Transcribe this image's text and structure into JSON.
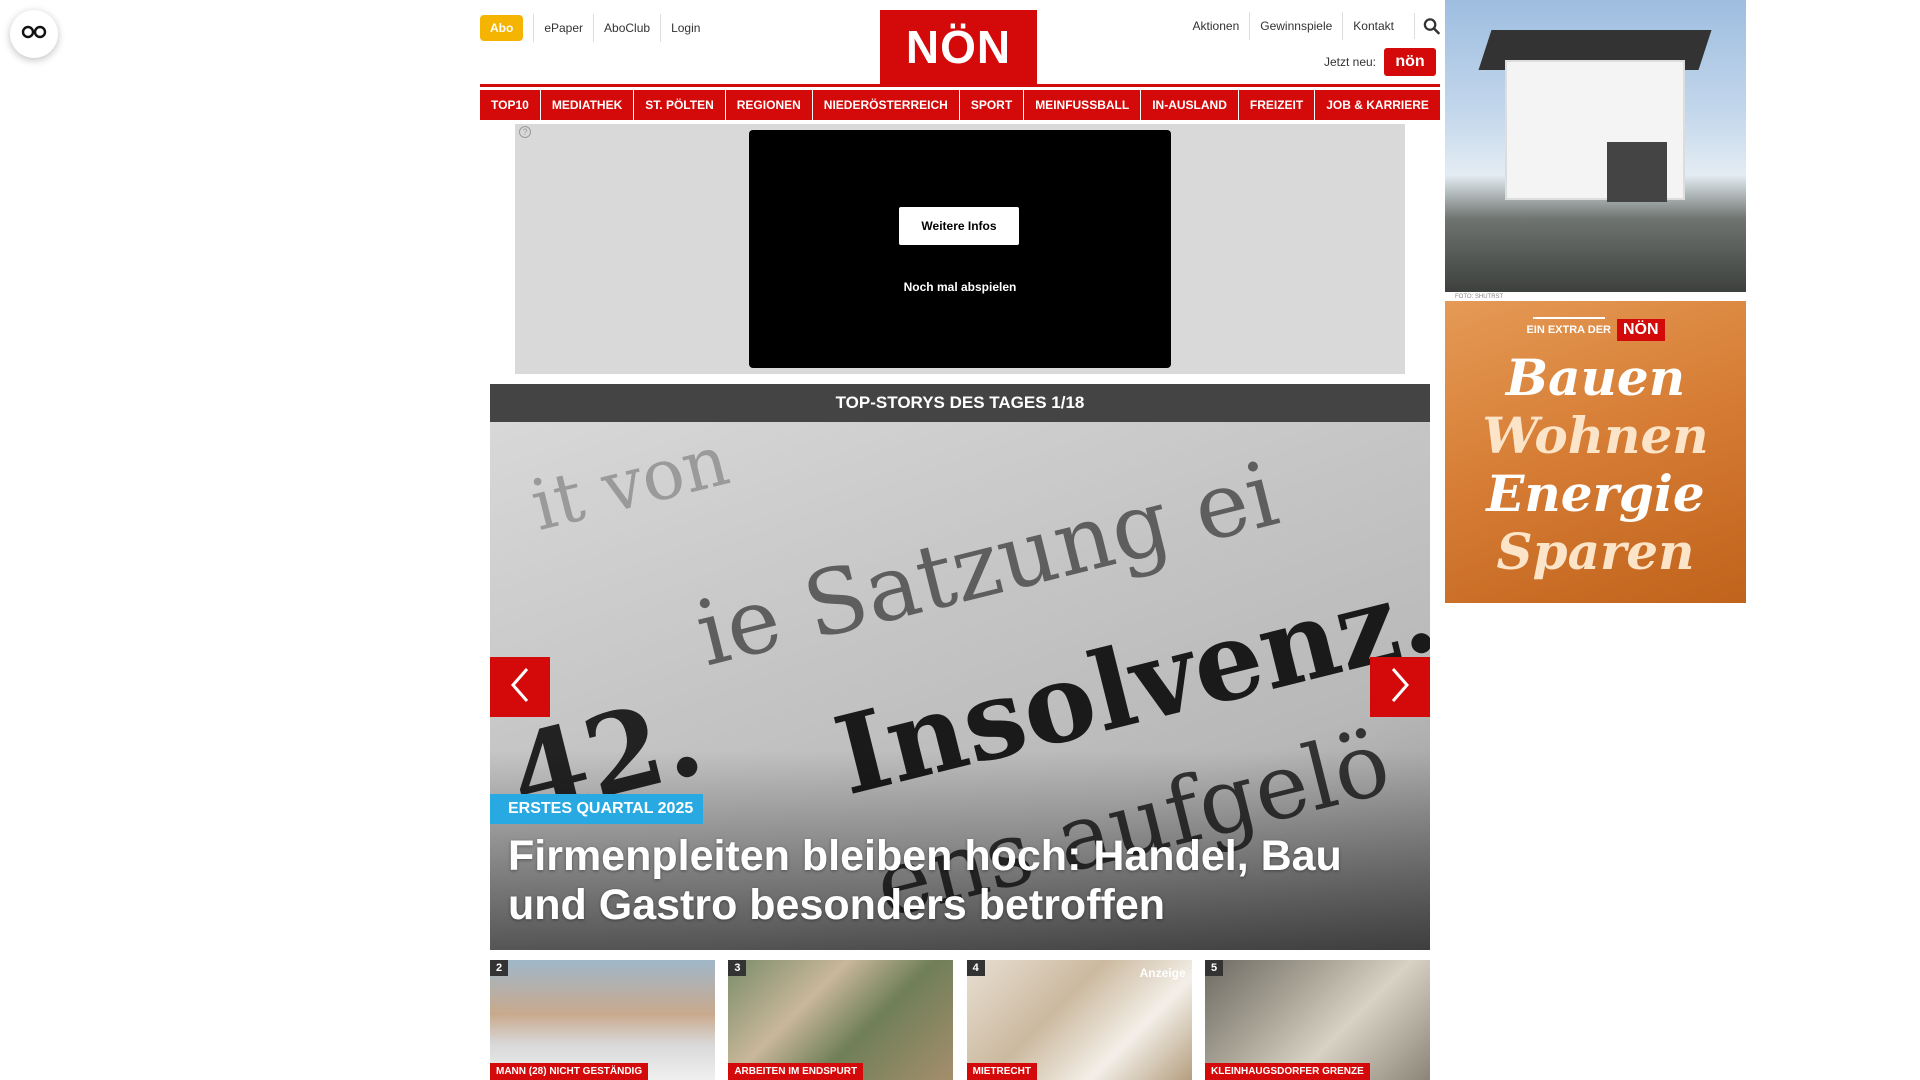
{
  "header": {
    "abo": "Abo",
    "left_links": [
      "ePaper",
      "AboClub",
      "Login"
    ],
    "logo": "NÖN",
    "right_links": [
      "Aktionen",
      "Gewinnspiele",
      "Kontakt"
    ],
    "jetzt_neu": "Jetzt neu:",
    "jetzt_badge": "nön"
  },
  "nav": [
    "TOP10",
    "MEDIATHEK",
    "ST. PÖLTEN",
    "REGIONEN",
    "NIEDERÖSTERREICH",
    "SPORT",
    "MEINFUSSBALL",
    "IN-AUSLAND",
    "FREIZEIT",
    "JOB & KARRIERE"
  ],
  "video_ad": {
    "info_icon": "?",
    "button": "Weitere Infos",
    "replay": "Noch mal abspielen"
  },
  "top_stories": {
    "title": "TOP-STORYS DES TAGES 1/18",
    "kicker": "ERSTES QUARTAL 2025",
    "headline": "Firmenpleiten bleiben hoch: Handel, Bau und Gastro besonders betroffen",
    "image_words": [
      "it von",
      "ie Satzung ei",
      "Insolvenz.",
      "ens aufgelö",
      "42."
    ]
  },
  "thumbs": [
    {
      "num": "2",
      "label": "MANN (28) NICHT GESTÄNDIG"
    },
    {
      "num": "3",
      "label": "ARBEITEN IM ENDSPURT"
    },
    {
      "num": "4",
      "label": "MIETRECHT",
      "badge": "Anzeige"
    },
    {
      "num": "5",
      "label": "KLEINHAUGSDORFER GRENZE"
    }
  ],
  "side_ad": {
    "foto_credit": "FOTO: SHUTRST",
    "extra": "EIN EXTRA DER",
    "extra_badge": "NÖN",
    "words": [
      "Bauen",
      "Wohnen",
      "Energie",
      "Sparen"
    ]
  },
  "icons": {
    "accessibility": "glasses-icon",
    "search": "search-icon",
    "prev": "chevron-left-icon",
    "next": "chevron-right-icon"
  },
  "colors": {
    "brand_red": "#d40a0a",
    "abo_yellow": "#f5b400",
    "kicker_blue": "#29a9e1",
    "ad_orange": "#d57b33"
  }
}
